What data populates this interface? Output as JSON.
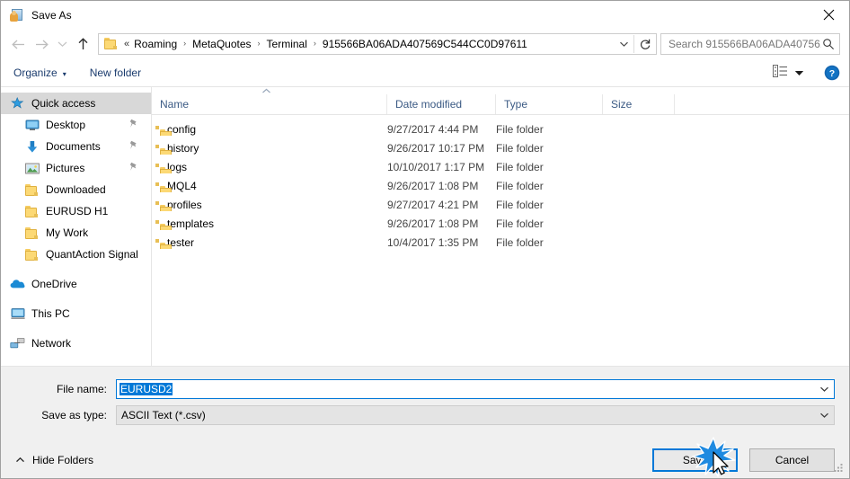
{
  "window": {
    "title": "Save As",
    "icon": "save-as-icon",
    "close_label": "✕"
  },
  "nav": {
    "back_icon": "arrow-left-icon",
    "forward_icon": "arrow-right-icon",
    "history_icon": "chevron-down-icon",
    "up_icon": "arrow-up-icon",
    "refresh_icon": "refresh-icon",
    "address_chevron_icon": "chevron-down-icon",
    "breadcrumb": {
      "leading": "«",
      "items": [
        "Roaming",
        "MetaQuotes",
        "Terminal",
        "915566BA06ADA407569C544CC0D97611"
      ],
      "separator": "›"
    },
    "search": {
      "placeholder": "Search 915566BA06ADA40756...",
      "icon": "search-icon"
    }
  },
  "toolbar": {
    "organize_label": "Organize",
    "organize_caret": "▾",
    "new_folder_label": "New folder",
    "view_icon": "view-layout-icon",
    "view_caret_icon": "caret-down-icon",
    "help_icon": "help-icon"
  },
  "sidebar": {
    "groups": [
      {
        "items": [
          {
            "label": "Quick access",
            "icon": "star-icon",
            "selected": true,
            "indent": false,
            "pinned": false
          },
          {
            "label": "Desktop",
            "icon": "desktop-icon",
            "selected": false,
            "indent": true,
            "pinned": true
          },
          {
            "label": "Documents",
            "icon": "documents-icon",
            "selected": false,
            "indent": true,
            "pinned": true
          },
          {
            "label": "Pictures",
            "icon": "pictures-icon",
            "selected": false,
            "indent": true,
            "pinned": true
          },
          {
            "label": "Downloaded",
            "icon": "folder-icon",
            "selected": false,
            "indent": true,
            "pinned": false
          },
          {
            "label": "EURUSD H1",
            "icon": "folder-icon",
            "selected": false,
            "indent": true,
            "pinned": false
          },
          {
            "label": "My Work",
            "icon": "folder-icon",
            "selected": false,
            "indent": true,
            "pinned": false
          },
          {
            "label": "QuantAction Signal",
            "icon": "folder-icon",
            "selected": false,
            "indent": true,
            "pinned": false
          }
        ]
      },
      {
        "items": [
          {
            "label": "OneDrive",
            "icon": "onedrive-icon",
            "selected": false,
            "indent": false,
            "pinned": false
          }
        ]
      },
      {
        "items": [
          {
            "label": "This PC",
            "icon": "this-pc-icon",
            "selected": false,
            "indent": false,
            "pinned": false
          }
        ]
      },
      {
        "items": [
          {
            "label": "Network",
            "icon": "network-icon",
            "selected": false,
            "indent": false,
            "pinned": false
          }
        ]
      }
    ]
  },
  "filelist": {
    "sort_column": "Name",
    "sort_direction": "ascending",
    "columns": [
      "Name",
      "Date modified",
      "Type",
      "Size"
    ],
    "rows": [
      {
        "name": "config",
        "date": "9/27/2017 4:44 PM",
        "type": "File folder",
        "size": ""
      },
      {
        "name": "history",
        "date": "9/26/2017 10:17 PM",
        "type": "File folder",
        "size": ""
      },
      {
        "name": "logs",
        "date": "10/10/2017 1:17 PM",
        "type": "File folder",
        "size": ""
      },
      {
        "name": "MQL4",
        "date": "9/26/2017 1:08 PM",
        "type": "File folder",
        "size": ""
      },
      {
        "name": "profiles",
        "date": "9/27/2017 4:21 PM",
        "type": "File folder",
        "size": ""
      },
      {
        "name": "templates",
        "date": "9/26/2017 1:08 PM",
        "type": "File folder",
        "size": ""
      },
      {
        "name": "tester",
        "date": "10/4/2017 1:35 PM",
        "type": "File folder",
        "size": ""
      }
    ]
  },
  "form": {
    "filename_label": "File name:",
    "filename_value": "EURUSD2",
    "filename_selected": true,
    "savetype_label": "Save as type:",
    "savetype_value": "ASCII Text (*.csv)",
    "dropdown_icon": "chevron-down-icon"
  },
  "footer": {
    "hide_folders_label": "Hide Folders",
    "hide_folders_icon": "chevron-up-icon",
    "save_label": "Save",
    "cancel_label": "Cancel",
    "resize_grip_icon": "resize-grip-icon",
    "cursor_icon": "mouse-pointer-icon",
    "click_effect": "click-burst"
  },
  "colors": {
    "accent": "#0078d7",
    "selection_bg": "#0078d7",
    "nav_selected_bg": "#d8d8d8",
    "folder_yellow": "#fcd975",
    "panel_bg": "#f0f0f0",
    "header_text": "#3b5a84"
  }
}
